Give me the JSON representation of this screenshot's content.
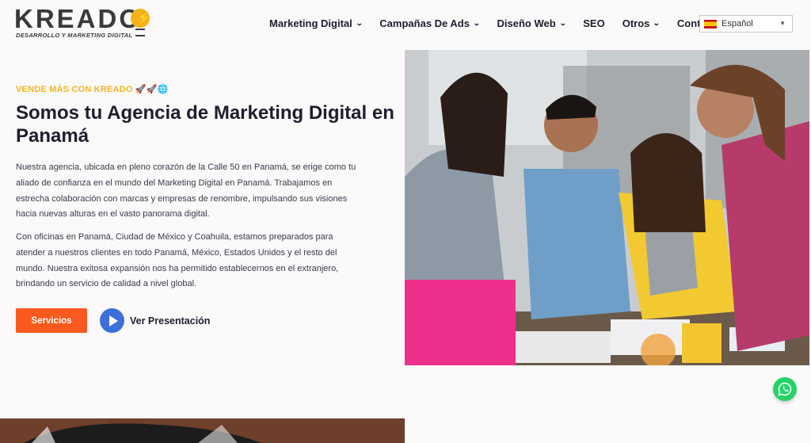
{
  "header": {
    "logo_text": "KREADO",
    "logo_tagline": "DESARROLLO Y MARKETING DIGITAL",
    "nav": [
      {
        "label": "Marketing Digital",
        "has_dropdown": true
      },
      {
        "label": "Campañas De Ads",
        "has_dropdown": true
      },
      {
        "label": "Diseño Web",
        "has_dropdown": true
      },
      {
        "label": "SEO",
        "has_dropdown": false
      },
      {
        "label": "Otros",
        "has_dropdown": true
      },
      {
        "label": "Contacto",
        "has_dropdown": true
      }
    ],
    "language": {
      "selected": "Español",
      "flag": "spain-flag-icon"
    }
  },
  "hero": {
    "eyebrow": "VENDE MÁS CON KREADO 🚀🚀🌐",
    "title": "Somos tu Agencia de Marketing Digital en Panamá",
    "paragraph1": "Nuestra agencia, ubicada en pleno corazón de la Calle 50 en Panamá, se erige como tu aliado de confianza en el mundo del Marketing Digital en Panamá. Trabajamos en estrecha colaboración con marcas y empresas de renombre, impulsando sus visiones hacia nuevas alturas en el vasto panorama digital.",
    "paragraph2": "Con oficinas en Panamá, Ciudad de México y Coahuila, estamos preparados para atender a nuestros clientes en todo Panamá, México, Estados Unidos y el resto del mundo. Nuestra exitosa expansión nos ha permitido establecernos en el extranjero, brindando un servicio de calidad a nivel global.",
    "primary_button": "Servicios",
    "video_button": "Ver Presentación"
  },
  "colors": {
    "accent_orange": "#fa5a1e",
    "eyebrow_yellow": "#f2b622",
    "play_blue": "#3c6fd8",
    "whatsapp_green": "#25d366"
  },
  "icons": {
    "play": "play-icon",
    "whatsapp": "whatsapp-icon",
    "bulb": "lightbulb-icon"
  }
}
